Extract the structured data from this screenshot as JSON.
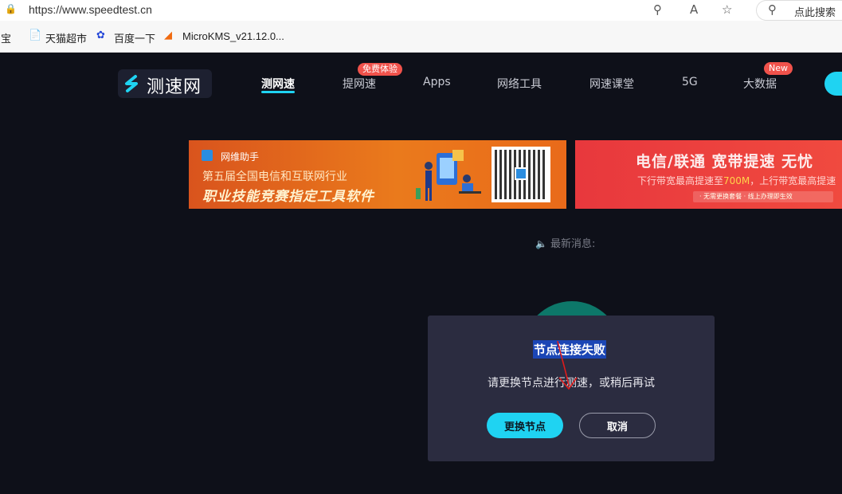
{
  "browser": {
    "url": "https://www.speedtest.cn",
    "search_placeholder": "点此搜索",
    "read_aloud_icon": "A",
    "bookmarks": [
      {
        "label": "淘宝"
      },
      {
        "label": "天猫超市"
      },
      {
        "label": "百度一下"
      },
      {
        "label": "MicroKMS_v21.12.0..."
      }
    ]
  },
  "site": {
    "logo_text": "测速网",
    "nav": [
      {
        "label": "测网速",
        "active": true
      },
      {
        "label": "提网速",
        "badge": "免费体验"
      },
      {
        "label": "Apps"
      },
      {
        "label": "网络工具"
      },
      {
        "label": "网速课堂"
      },
      {
        "label": "5G"
      },
      {
        "label": "大数据",
        "badge": "New"
      }
    ],
    "accent_color": "#1fd3f2",
    "badge_color": "#f0524b"
  },
  "banner1": {
    "brand": "网维助手",
    "line1": "第五届全国电信和互联网行业",
    "line2": "职业技能竞赛指定工具软件"
  },
  "banner2": {
    "title": "电信/联通 宽带提速 无忧",
    "subtitle_pre": "下行带宽最高提速至",
    "subtitle_hl": "700M",
    "subtitle_post": "，上行带宽最高提速",
    "bar_text": "· 无需更换套餐   · 线上办理即生效"
  },
  "news_label": "最新消息:",
  "dialog": {
    "title": "节点连接失败",
    "message": "请更换节点进行测速，或稍后再试",
    "confirm_label": "更换节点",
    "cancel_label": "取消"
  }
}
